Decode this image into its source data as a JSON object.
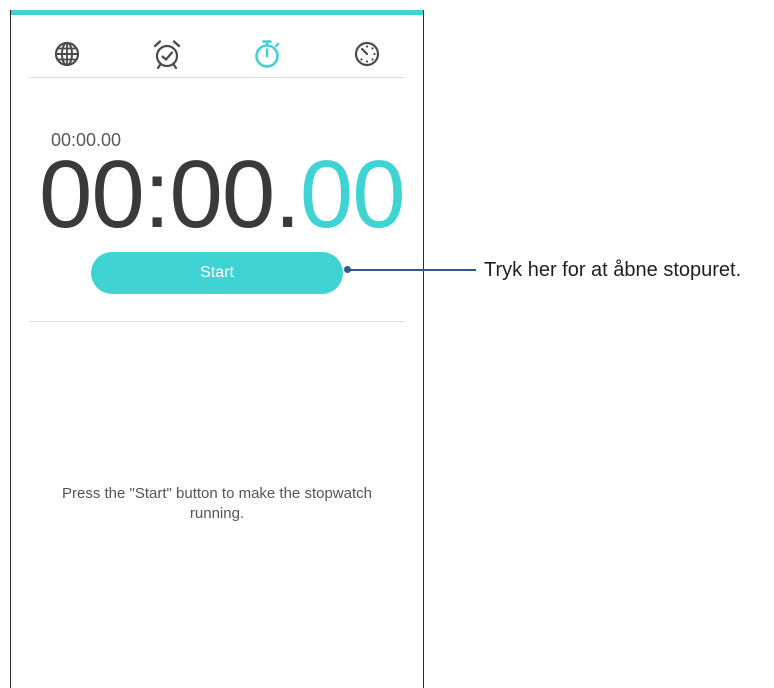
{
  "colors": {
    "accent": "#3fd3d3",
    "callout": "#2d5a86"
  },
  "tabs": [
    {
      "icon": "globe-icon",
      "active": false
    },
    {
      "icon": "alarm-clock-icon",
      "active": false
    },
    {
      "icon": "stopwatch-icon",
      "active": true
    },
    {
      "icon": "timer-icon",
      "active": false
    }
  ],
  "stopwatch": {
    "previous_time": "00:00.00",
    "main_time": "00:00.",
    "hundredths": "00",
    "start_label": "Start",
    "hint": "Press the \"Start\" button to make the stopwatch running."
  },
  "callout": {
    "text": "Tryk her for at åbne stopuret."
  }
}
